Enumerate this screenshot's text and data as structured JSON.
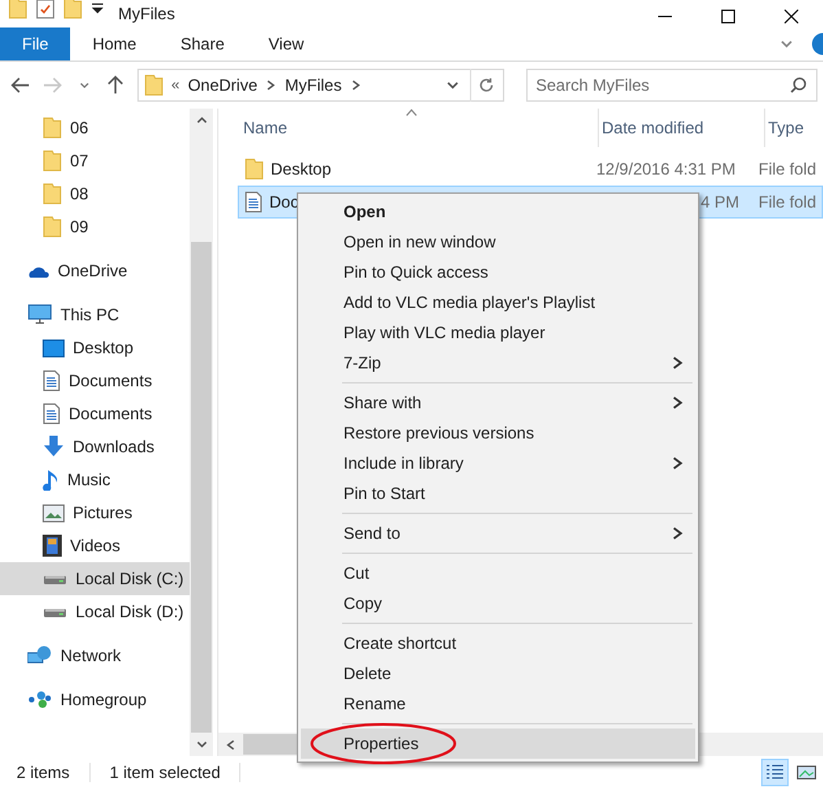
{
  "window": {
    "title": "MyFiles"
  },
  "ribbon_tabs": [
    {
      "label": "File",
      "selected": true
    },
    {
      "label": "Home",
      "selected": false
    },
    {
      "label": "Share",
      "selected": false
    },
    {
      "label": "View",
      "selected": false
    }
  ],
  "address": {
    "prefix": "«",
    "crumbs": [
      "OneDrive",
      "MyFiles"
    ]
  },
  "search": {
    "placeholder": "Search MyFiles"
  },
  "sidebar": {
    "items": [
      {
        "label": "06",
        "kind": "folder",
        "selected": false,
        "indent": true
      },
      {
        "label": "07",
        "kind": "folder",
        "selected": false,
        "indent": true
      },
      {
        "label": "08",
        "kind": "folder",
        "selected": false,
        "indent": true
      },
      {
        "label": "09",
        "kind": "folder",
        "selected": false,
        "indent": true
      },
      {
        "label": "OneDrive",
        "kind": "cloud",
        "selected": false,
        "indent": false
      },
      {
        "label": "This PC",
        "kind": "pc",
        "selected": false,
        "indent": false,
        "children": [
          {
            "label": "Desktop",
            "kind": "desktop",
            "selected": false
          },
          {
            "label": "Documents",
            "kind": "document",
            "selected": false
          },
          {
            "label": "Documents",
            "kind": "document",
            "selected": false
          },
          {
            "label": "Downloads",
            "kind": "download",
            "selected": false
          },
          {
            "label": "Music",
            "kind": "music",
            "selected": false
          },
          {
            "label": "Pictures",
            "kind": "pictures",
            "selected": false
          },
          {
            "label": "Videos",
            "kind": "videos",
            "selected": false
          },
          {
            "label": "Local Disk (C:)",
            "kind": "disk",
            "selected": true
          },
          {
            "label": "Local Disk (D:)",
            "kind": "disk",
            "selected": false
          }
        ]
      },
      {
        "label": "Network",
        "kind": "network",
        "selected": false,
        "indent": false
      },
      {
        "label": "Homegroup",
        "kind": "homegroup",
        "selected": false,
        "indent": false
      }
    ]
  },
  "table": {
    "columns": [
      "Name",
      "Date modified",
      "Type"
    ],
    "rows": [
      {
        "kind": "folder",
        "name": "Desktop",
        "date": "12/9/2016 4:31 PM",
        "type": "File fold",
        "selected": false
      },
      {
        "kind": "document",
        "name": "Doc",
        "date": "4 PM",
        "type": "File fold",
        "selected": true
      }
    ]
  },
  "context_menu": {
    "items": [
      {
        "kind": "item",
        "label": "Open",
        "default": true,
        "submenu": false,
        "highlighted": false
      },
      {
        "kind": "item",
        "label": "Open in new window",
        "default": false,
        "submenu": false,
        "highlighted": false
      },
      {
        "kind": "item",
        "label": "Pin to Quick access",
        "default": false,
        "submenu": false,
        "highlighted": false
      },
      {
        "kind": "item",
        "label": "Add to VLC media player's Playlist",
        "default": false,
        "submenu": false,
        "highlighted": false
      },
      {
        "kind": "item",
        "label": "Play with VLC media player",
        "default": false,
        "submenu": false,
        "highlighted": false
      },
      {
        "kind": "item",
        "label": "7-Zip",
        "default": false,
        "submenu": true,
        "highlighted": false
      },
      {
        "kind": "separator"
      },
      {
        "kind": "item",
        "label": "Share with",
        "default": false,
        "submenu": true,
        "highlighted": false
      },
      {
        "kind": "item",
        "label": "Restore previous versions",
        "default": false,
        "submenu": false,
        "highlighted": false
      },
      {
        "kind": "item",
        "label": "Include in library",
        "default": false,
        "submenu": true,
        "highlighted": false
      },
      {
        "kind": "item",
        "label": "Pin to Start",
        "default": false,
        "submenu": false,
        "highlighted": false
      },
      {
        "kind": "separator"
      },
      {
        "kind": "item",
        "label": "Send to",
        "default": false,
        "submenu": true,
        "highlighted": false
      },
      {
        "kind": "separator"
      },
      {
        "kind": "item",
        "label": "Cut",
        "default": false,
        "submenu": false,
        "highlighted": false
      },
      {
        "kind": "item",
        "label": "Copy",
        "default": false,
        "submenu": false,
        "highlighted": false
      },
      {
        "kind": "separator"
      },
      {
        "kind": "item",
        "label": "Create shortcut",
        "default": false,
        "submenu": false,
        "highlighted": false
      },
      {
        "kind": "item",
        "label": "Delete",
        "default": false,
        "submenu": false,
        "highlighted": false
      },
      {
        "kind": "item",
        "label": "Rename",
        "default": false,
        "submenu": false,
        "highlighted": false
      },
      {
        "kind": "separator"
      },
      {
        "kind": "item",
        "label": "Properties",
        "default": false,
        "submenu": false,
        "highlighted": true,
        "circled": true
      }
    ]
  },
  "status_bar": {
    "items": [
      "2 items",
      "1 item selected"
    ]
  }
}
